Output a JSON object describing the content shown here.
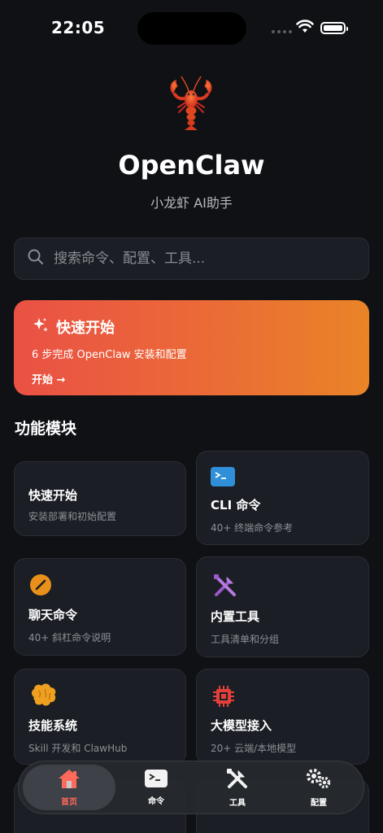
{
  "status": {
    "time": "22:05"
  },
  "app": {
    "title": "OpenClaw",
    "subtitle": "小龙虾 AI助手"
  },
  "search": {
    "placeholder": "搜索命令、配置、工具..."
  },
  "banner": {
    "title": "快速开始",
    "description": "6 步完成 OpenClaw 安装和配置",
    "cta": "开始 →"
  },
  "section": {
    "title": "功能模块"
  },
  "modules": [
    {
      "title": "快速开始",
      "desc": "安装部署和初始配置",
      "icon": "none"
    },
    {
      "title": "CLI 命令",
      "desc": "40+ 终端命令参考",
      "icon": "terminal-icon"
    },
    {
      "title": "聊天命令",
      "desc": "40+ 斜杠命令说明",
      "icon": "slash-icon"
    },
    {
      "title": "内置工具",
      "desc": "工具清单和分组",
      "icon": "tools-icon"
    },
    {
      "title": "技能系统",
      "desc": "Skill 开发和 ClawHub",
      "icon": "brain-icon"
    },
    {
      "title": "大模型接入",
      "desc": "20+ 云端/本地模型",
      "icon": "chip-icon"
    }
  ],
  "tabs": [
    {
      "label": "首页",
      "icon": "home-icon"
    },
    {
      "label": "命令",
      "icon": "terminal-icon"
    },
    {
      "label": "工具",
      "icon": "tools-icon"
    },
    {
      "label": "配置",
      "icon": "gears-icon"
    }
  ],
  "colors": {
    "accent": "#ff6a5a",
    "banner_start": "#ea5145",
    "banner_end": "#e98427",
    "background": "#0f1115"
  }
}
